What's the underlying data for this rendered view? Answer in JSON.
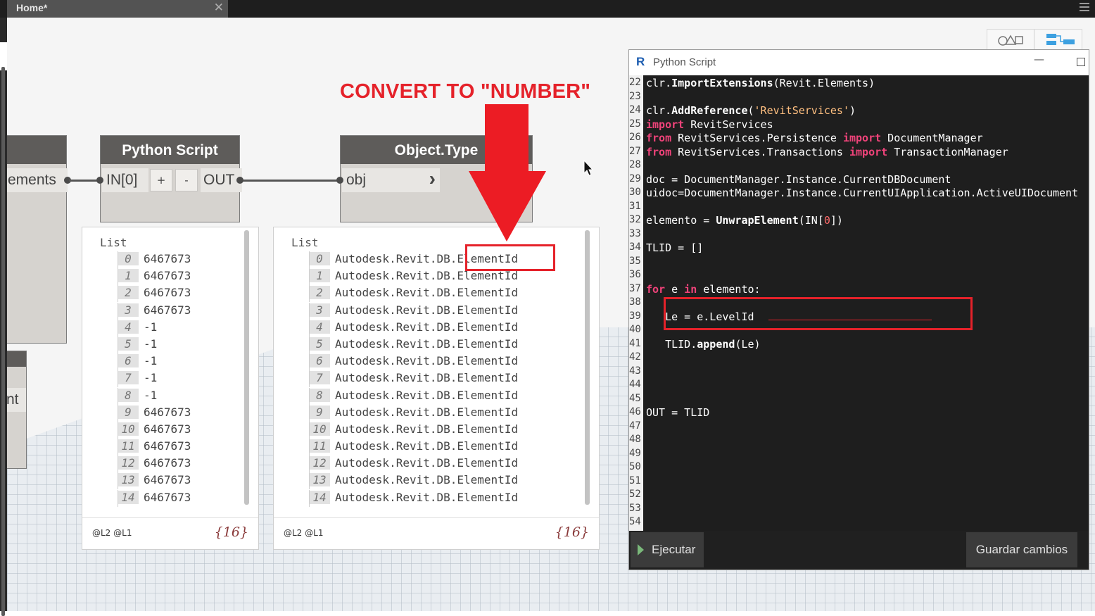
{
  "tab": {
    "title": "Home*",
    "close": "✕"
  },
  "annotation": {
    "text": "CONVERT TO \"NUMBER\""
  },
  "nodes": {
    "left_partial": {
      "port": "ements"
    },
    "left_partial2": {
      "port": "nt"
    },
    "python": {
      "title": "Python Script",
      "input": "IN[0]",
      "add": "+",
      "remove": "-",
      "output": "OUT"
    },
    "objtype": {
      "title": "Object.Type",
      "input": "obj",
      "arrow": "›"
    }
  },
  "preview1": {
    "title": "List",
    "rows": [
      {
        "i": "0",
        "v": "6467673"
      },
      {
        "i": "1",
        "v": "6467673"
      },
      {
        "i": "2",
        "v": "6467673"
      },
      {
        "i": "3",
        "v": "6467673"
      },
      {
        "i": "4",
        "v": "-1"
      },
      {
        "i": "5",
        "v": "-1"
      },
      {
        "i": "6",
        "v": "-1"
      },
      {
        "i": "7",
        "v": "-1"
      },
      {
        "i": "8",
        "v": "-1"
      },
      {
        "i": "9",
        "v": "6467673"
      },
      {
        "i": "10",
        "v": "6467673"
      },
      {
        "i": "11",
        "v": "6467673"
      },
      {
        "i": "12",
        "v": "6467673"
      },
      {
        "i": "13",
        "v": "6467673"
      },
      {
        "i": "14",
        "v": "6467673"
      }
    ],
    "levels": "@L2 @L1",
    "count": "{16}"
  },
  "preview2": {
    "title": "List",
    "rows": [
      {
        "i": "0",
        "v": "Autodesk.Revit.DB.ElementId"
      },
      {
        "i": "1",
        "v": "Autodesk.Revit.DB.ElementId"
      },
      {
        "i": "2",
        "v": "Autodesk.Revit.DB.ElementId"
      },
      {
        "i": "3",
        "v": "Autodesk.Revit.DB.ElementId"
      },
      {
        "i": "4",
        "v": "Autodesk.Revit.DB.ElementId"
      },
      {
        "i": "5",
        "v": "Autodesk.Revit.DB.ElementId"
      },
      {
        "i": "6",
        "v": "Autodesk.Revit.DB.ElementId"
      },
      {
        "i": "7",
        "v": "Autodesk.Revit.DB.ElementId"
      },
      {
        "i": "8",
        "v": "Autodesk.Revit.DB.ElementId"
      },
      {
        "i": "9",
        "v": "Autodesk.Revit.DB.ElementId"
      },
      {
        "i": "10",
        "v": "Autodesk.Revit.DB.ElementId"
      },
      {
        "i": "11",
        "v": "Autodesk.Revit.DB.ElementId"
      },
      {
        "i": "12",
        "v": "Autodesk.Revit.DB.ElementId"
      },
      {
        "i": "13",
        "v": "Autodesk.Revit.DB.ElementId"
      },
      {
        "i": "14",
        "v": "Autodesk.Revit.DB.ElementId"
      }
    ],
    "levels": "@L2 @L1",
    "count": "{16}"
  },
  "editor": {
    "title": "Python Script",
    "icon_letter": "R",
    "minimize": "—",
    "run_label": "Ejecutar",
    "save_label": "Guardar cambios",
    "lines": [
      {
        "n": "22",
        "segs": [
          [
            "t",
            "clr."
          ],
          [
            "f",
            "ImportExtensions"
          ],
          [
            "t",
            "(Revit.Elements)"
          ]
        ]
      },
      {
        "n": "23",
        "segs": []
      },
      {
        "n": "24",
        "segs": [
          [
            "t",
            "clr."
          ],
          [
            "f",
            "AddReference"
          ],
          [
            "t",
            "("
          ],
          [
            "s",
            "'RevitServices'"
          ],
          [
            "t",
            ")"
          ]
        ]
      },
      {
        "n": "25",
        "segs": [
          [
            "k",
            "import"
          ],
          [
            "t",
            " RevitServices"
          ]
        ]
      },
      {
        "n": "26",
        "segs": [
          [
            "k",
            "from"
          ],
          [
            "t",
            " RevitServices.Persistence "
          ],
          [
            "k",
            "import"
          ],
          [
            "t",
            " DocumentManager"
          ]
        ]
      },
      {
        "n": "27",
        "segs": [
          [
            "k",
            "from"
          ],
          [
            "t",
            " RevitServices.Transactions "
          ],
          [
            "k",
            "import"
          ],
          [
            "t",
            " TransactionManager"
          ]
        ]
      },
      {
        "n": "28",
        "segs": []
      },
      {
        "n": "29",
        "segs": [
          [
            "t",
            "doc = DocumentManager.Instance.CurrentDBDocument"
          ]
        ]
      },
      {
        "n": "30",
        "segs": [
          [
            "t",
            "uidoc=DocumentManager.Instance.CurrentUIApplication.ActiveUIDocument"
          ]
        ]
      },
      {
        "n": "31",
        "segs": []
      },
      {
        "n": "32",
        "segs": [
          [
            "t",
            "elemento = "
          ],
          [
            "f",
            "UnwrapElement"
          ],
          [
            "t",
            "(IN["
          ],
          [
            "n",
            "0"
          ],
          [
            "t",
            "])"
          ]
        ]
      },
      {
        "n": "33",
        "segs": []
      },
      {
        "n": "34",
        "segs": [
          [
            "t",
            "TLID = []"
          ]
        ]
      },
      {
        "n": "35",
        "segs": []
      },
      {
        "n": "36",
        "segs": []
      },
      {
        "n": "37",
        "segs": [
          [
            "k",
            "for"
          ],
          [
            "t",
            " e "
          ],
          [
            "k",
            "in"
          ],
          [
            "t",
            " elemento:"
          ]
        ]
      },
      {
        "n": "38",
        "segs": []
      },
      {
        "n": "39",
        "segs": [
          [
            "t",
            "   Le = e.LevelId"
          ]
        ]
      },
      {
        "n": "40",
        "segs": []
      },
      {
        "n": "41",
        "segs": [
          [
            "t",
            "   TLID."
          ],
          [
            "f",
            "append"
          ],
          [
            "t",
            "(Le)"
          ]
        ]
      },
      {
        "n": "42",
        "segs": []
      },
      {
        "n": "43",
        "segs": []
      },
      {
        "n": "44",
        "segs": []
      },
      {
        "n": "45",
        "segs": []
      },
      {
        "n": "46",
        "segs": [
          [
            "t",
            "OUT = TLID"
          ]
        ]
      },
      {
        "n": "47",
        "segs": []
      },
      {
        "n": "48",
        "segs": []
      },
      {
        "n": "49",
        "segs": []
      },
      {
        "n": "50",
        "segs": []
      },
      {
        "n": "51",
        "segs": []
      },
      {
        "n": "52",
        "segs": []
      },
      {
        "n": "53",
        "segs": []
      },
      {
        "n": "54",
        "segs": []
      }
    ]
  },
  "colors": {
    "annotation_red": "#e5222a",
    "node_header": "#5e5c5a",
    "keyword_pink": "#f0437a",
    "string_orange": "#ffbf80"
  }
}
